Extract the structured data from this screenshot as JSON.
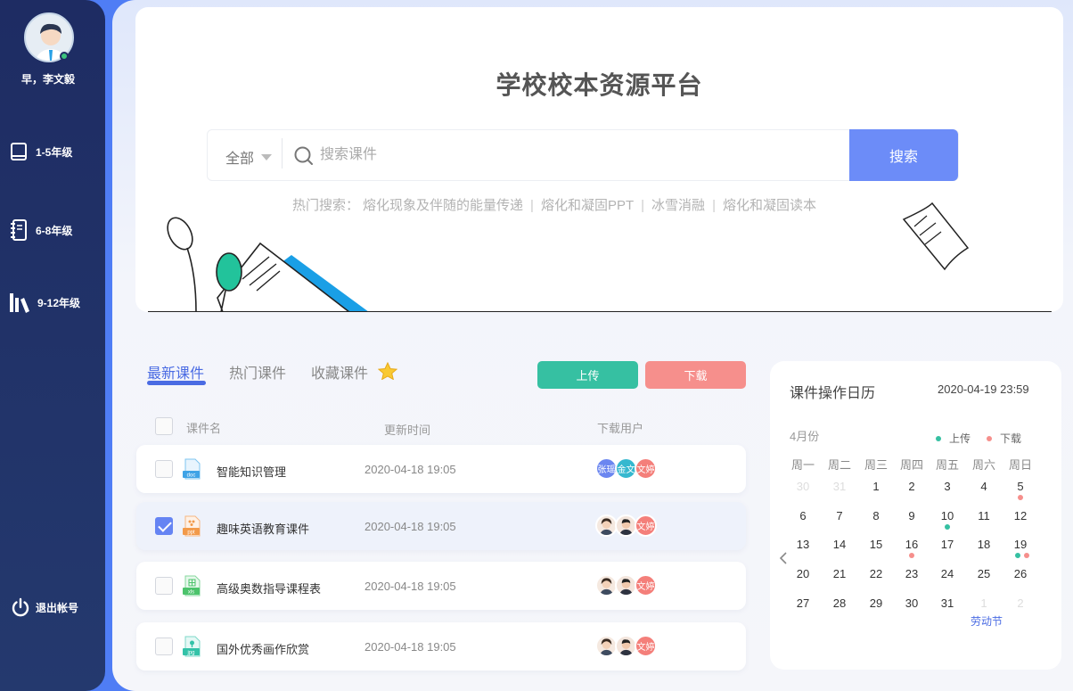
{
  "sidebar": {
    "greeting": "早，李文毅",
    "items": [
      {
        "label": "1-5年级",
        "icon": "book-icon"
      },
      {
        "label": "6-8年级",
        "icon": "notebook-icon"
      },
      {
        "label": "9-12年级",
        "icon": "library-icon"
      }
    ],
    "logout": "退出帐号"
  },
  "hero": {
    "title": "学校校本资源平台",
    "scope": "全部",
    "search_placeholder": "搜索课件",
    "search_button": "搜索",
    "hot_label": "热门搜索：",
    "hot_terms": [
      "熔化现象及伴随的能量传递",
      "熔化和凝固PPT",
      "冰雪消融",
      "熔化和凝固读本"
    ]
  },
  "tabs": [
    "最新课件",
    "热门课件",
    "收藏课件"
  ],
  "actions": {
    "upload": "上传",
    "download": "下载"
  },
  "table": {
    "headers": [
      "课件名",
      "更新时间",
      "下载用户"
    ],
    "rows": [
      {
        "type": "doc",
        "name": "智能知识管理",
        "time": "2020-04-18 19:05",
        "checked": false,
        "users": [
          {
            "label": "张瑶",
            "color": "#6b86f0"
          },
          {
            "label": "金文",
            "color": "#36b8cf"
          },
          {
            "label": "文婷",
            "color": "#f47f7a"
          }
        ]
      },
      {
        "type": "ppt",
        "name": "趣味英语教育课件",
        "time": "2020-04-18 19:05",
        "checked": true,
        "users": [
          {
            "label": "",
            "color": "#f5e9e0"
          },
          {
            "label": "",
            "color": "#f3e5dc"
          },
          {
            "label": "文婷",
            "color": "#f47f7a"
          }
        ]
      },
      {
        "type": "xls",
        "name": "高级奥数指导课程表",
        "time": "2020-04-18 19:05",
        "checked": false,
        "users": [
          {
            "label": "",
            "color": "#f5e9e0"
          },
          {
            "label": "",
            "color": "#f3e5dc"
          },
          {
            "label": "文婷",
            "color": "#f47f7a"
          }
        ]
      },
      {
        "type": "pic",
        "name": "国外优秀画作欣赏",
        "time": "2020-04-18 19:05",
        "checked": false,
        "users": [
          {
            "label": "",
            "color": "#f5e9e0"
          },
          {
            "label": "",
            "color": "#f3e5dc"
          },
          {
            "label": "文婷",
            "color": "#f47f7a"
          }
        ]
      }
    ]
  },
  "calendar": {
    "title": "课件操作日历",
    "now": "2020-04-19 23:59",
    "month": "4月份",
    "legend": {
      "upload": "上传",
      "download": "下载"
    },
    "weekdays": [
      "周一",
      "周二",
      "周三",
      "周四",
      "周五",
      "周六",
      "周日"
    ],
    "weeks": [
      [
        "30",
        "31",
        "1",
        "2",
        "3",
        "4",
        "5"
      ],
      [
        "6",
        "7",
        "8",
        "9",
        "10",
        "11",
        "12"
      ],
      [
        "13",
        "14",
        "15",
        "16",
        "17",
        "18",
        "19"
      ],
      [
        "20",
        "21",
        "22",
        "23",
        "24",
        "25",
        "26"
      ],
      [
        "27",
        "28",
        "29",
        "30",
        "31",
        "1",
        "2"
      ]
    ],
    "muted_days": [
      "30",
      "31",
      "1",
      "2"
    ],
    "today": "19",
    "upload_days": [
      "10",
      "19"
    ],
    "download_days": [
      "5",
      "16",
      "19"
    ],
    "holiday": "劳动节",
    "colors": {
      "upload": "#36c0a2",
      "download": "#f68f8c"
    }
  }
}
